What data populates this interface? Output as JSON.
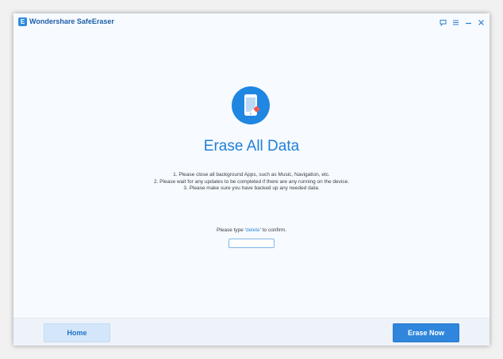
{
  "app": {
    "logo_letter": "E",
    "title": "Wondershare SafeEraser"
  },
  "titlebar_controls": [
    {
      "name": "feedback-icon"
    },
    {
      "name": "menu-icon"
    },
    {
      "name": "minimize-icon"
    },
    {
      "name": "close-icon"
    }
  ],
  "main": {
    "hero_icon": "phone-eraser-icon",
    "title": "Erase All Data",
    "instructions": [
      "1. Please close all background Apps, such as Music, Navigation, etc.",
      "2. Please wait for any updates to be completed if there are any running on the device.",
      "3. Please make sure you have backed up any needed data."
    ],
    "confirm": {
      "prefix": "Please type '",
      "keyword": "delete",
      "suffix": "' to confirm.",
      "input_value": ""
    }
  },
  "footer": {
    "home_label": "Home",
    "erase_label": "Erase Now"
  },
  "colors": {
    "accent": "#1f86e2",
    "title_text": "#1f7fd8",
    "primary_button": "#2f86dc",
    "secondary_button": "#d4e6f9"
  }
}
